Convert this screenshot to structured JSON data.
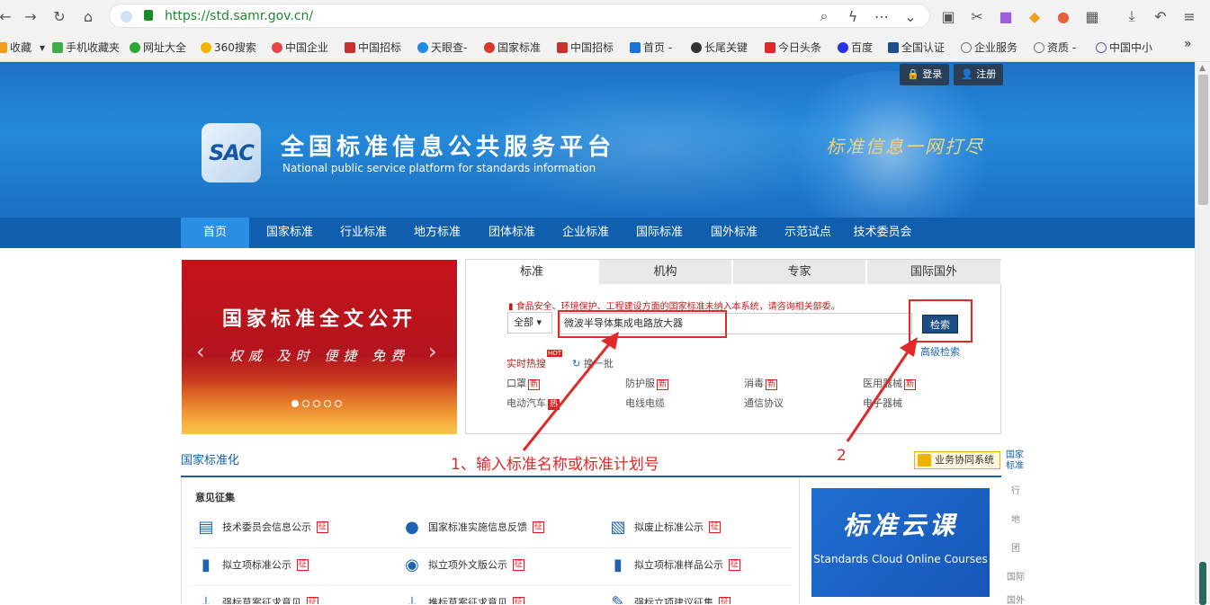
{
  "browser": {
    "url": "https://std.samr.gov.cn/",
    "bookmarks": [
      "收藏",
      "手机收藏夹",
      "网址大全",
      "360搜索",
      "中国企业",
      "中国招标",
      "天眼查-",
      "国家标准",
      "中国招标",
      "首页 -",
      "长尾关键",
      "今日头条",
      "百度",
      "全国认证",
      "企业服务",
      "资质 -",
      "中国中小"
    ],
    "more": "»"
  },
  "header": {
    "login": "登录",
    "register": "注册",
    "logo_text": "SAC",
    "title": "全国标准信息公共服务平台",
    "subtitle": "National public service platform  for standards information",
    "slogan": "标准信息一网打尽"
  },
  "nav": [
    "首页",
    "国家标准",
    "行业标准",
    "地方标准",
    "团体标准",
    "企业标准",
    "国际标准",
    "国外标准",
    "示范试点",
    "技术委员会"
  ],
  "carousel": {
    "headline": "国家标准全文公开",
    "tagline": "权威 及时 便捷 免费"
  },
  "search": {
    "tabs": [
      "标准",
      "机构",
      "专家",
      "国际国外"
    ],
    "notice": "食品安全、环境保护、工程建设方面的国家标准未纳入本系统，请咨询相关部委。",
    "scope_select": "全部",
    "query": "微波半导体集成电路放大器",
    "submit": "检索",
    "advanced": "高级检索",
    "hot_label": "实时热搜",
    "hot_badge": "HOT",
    "refresh": "换一批",
    "keywords": [
      {
        "text": "口罩",
        "tag": "新"
      },
      {
        "text": "防护服",
        "tag": "新"
      },
      {
        "text": "消毒",
        "tag": "新"
      },
      {
        "text": "医用器械",
        "tag": "新"
      },
      {
        "text": "电动汽车",
        "tag": "热"
      },
      {
        "text": "电线电缆",
        "tag": ""
      },
      {
        "text": "通信协议",
        "tag": ""
      },
      {
        "text": "电子器械",
        "tag": ""
      }
    ]
  },
  "annotations": {
    "step1": "1、输入标准名称或标准计划号",
    "step2": "2"
  },
  "section": {
    "title": "国家标准化",
    "biz_button": "业务协同系统",
    "opinion_title": "意见征集",
    "items": [
      {
        "label": "技术委员会信息公示",
        "tag": "征"
      },
      {
        "label": "国家标准实施信息反馈",
        "tag": "征"
      },
      {
        "label": "拟废止标准公示",
        "tag": "征"
      },
      {
        "label": "拟立项标准公示",
        "tag": "征"
      },
      {
        "label": "拟立项外文版公示",
        "tag": "征"
      },
      {
        "label": "拟立项标准样品公示",
        "tag": "征"
      },
      {
        "label": "强标草案征求意见",
        "tag": "征"
      },
      {
        "label": "推标草案征求意见",
        "tag": "征"
      },
      {
        "label": "强标立项建议征集",
        "tag": "征"
      }
    ]
  },
  "cloud": {
    "title": "标准云课",
    "subtitle": "Standards Cloud Online Courses"
  },
  "side_tabs": [
    "国家标准",
    "行",
    "地",
    "团",
    "国际",
    "国外"
  ],
  "colors": {
    "brand_blue": "#1d72c6",
    "nav_blue": "#0f5fae",
    "annotation_red": "#e02929",
    "search_button": "#1d4e81"
  }
}
